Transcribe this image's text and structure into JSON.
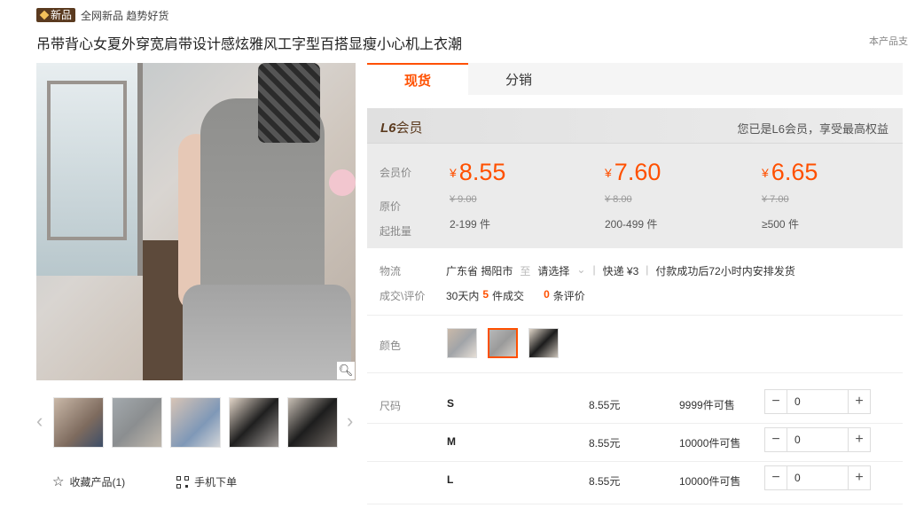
{
  "header": {
    "badge": "新品",
    "tags": "全网新品 趋势好货",
    "title": "吊带背心女夏外穿宽肩带设计感炫雅风工字型百搭显瘦小心机上衣潮",
    "aside_note": "本产品支"
  },
  "gallery": {
    "thumbnail_count": 5,
    "prev_icon": "chevron-left-icon",
    "next_icon": "chevron-right-icon",
    "zoom_icon": "magnifier-icon"
  },
  "actions": {
    "favorite": "收藏产品(1)",
    "mobile_order": "手机下单"
  },
  "tabs": [
    {
      "label": "现货",
      "active": true
    },
    {
      "label": "分销",
      "active": false
    }
  ],
  "pricing": {
    "member_level": "L6",
    "member_suffix": "会员",
    "member_note": "您已是L6会员，享受最高权益",
    "labels": {
      "member_price": "会员价",
      "original_price": "原价",
      "min_qty": "起批量"
    },
    "currency": "¥",
    "tiers": [
      {
        "price": "8.55",
        "original": "¥ 9.00",
        "qty": "2-199 件"
      },
      {
        "price": "7.60",
        "original": "¥ 8.00",
        "qty": "200-499 件"
      },
      {
        "price": "6.65",
        "original": "¥ 7.00",
        "qty": "≥500 件"
      }
    ],
    "accent_color": "#ff5000"
  },
  "logistics": {
    "label": "物流",
    "origin": "广东省 揭阳市",
    "to": "至",
    "destination": "请选择",
    "express": "快递 ¥3",
    "ship_note": "付款成功后72小时内安排发货"
  },
  "sales": {
    "label": "成交\\评价",
    "prefix": "30天内",
    "count": "5",
    "count_suffix": "件成交",
    "reviews": "0",
    "reviews_suffix": "条评价"
  },
  "color": {
    "label": "颜色",
    "selected_index": 1
  },
  "sizes": {
    "label": "尺码",
    "rows": [
      {
        "name": "S",
        "price": "8.55元",
        "stock": "9999件可售",
        "qty": "0"
      },
      {
        "name": "M",
        "price": "8.55元",
        "stock": "10000件可售",
        "qty": "0"
      },
      {
        "name": "L",
        "price": "8.55元",
        "stock": "10000件可售",
        "qty": "0"
      }
    ]
  }
}
